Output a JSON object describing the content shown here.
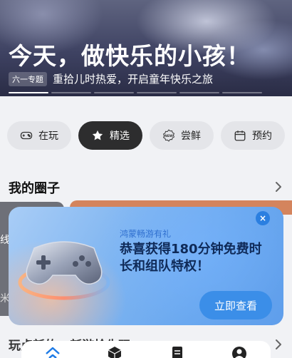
{
  "hero": {
    "title": "今天，做快乐的小孩！",
    "tag": "六一专题",
    "subtitle": "重拾儿时热爱，开启童年快乐之旅"
  },
  "chips": [
    {
      "label": "在玩",
      "icon": "gamepad-icon",
      "active": false
    },
    {
      "label": "精选",
      "icon": "star-icon",
      "active": true
    },
    {
      "label": "尝鲜",
      "icon": "new-badge-icon",
      "active": false
    },
    {
      "label": "预约",
      "icon": "calendar-icon",
      "active": false
    }
  ],
  "circles": {
    "title": "我的圈子",
    "side_text_top": "线",
    "side_text_bottom": "米"
  },
  "popup": {
    "small_text": "鸿蒙畅游有礼",
    "headline": "恭喜获得180分钟免费时长和组队特权！",
    "button": "立即查看",
    "close": "×"
  },
  "section2": {
    "title": "玩点新的 · 新游抢先玩"
  },
  "colors": {
    "accent": "#3b8ee8",
    "chip_active": "#2d2d2e",
    "headline": "#0f2a58"
  }
}
